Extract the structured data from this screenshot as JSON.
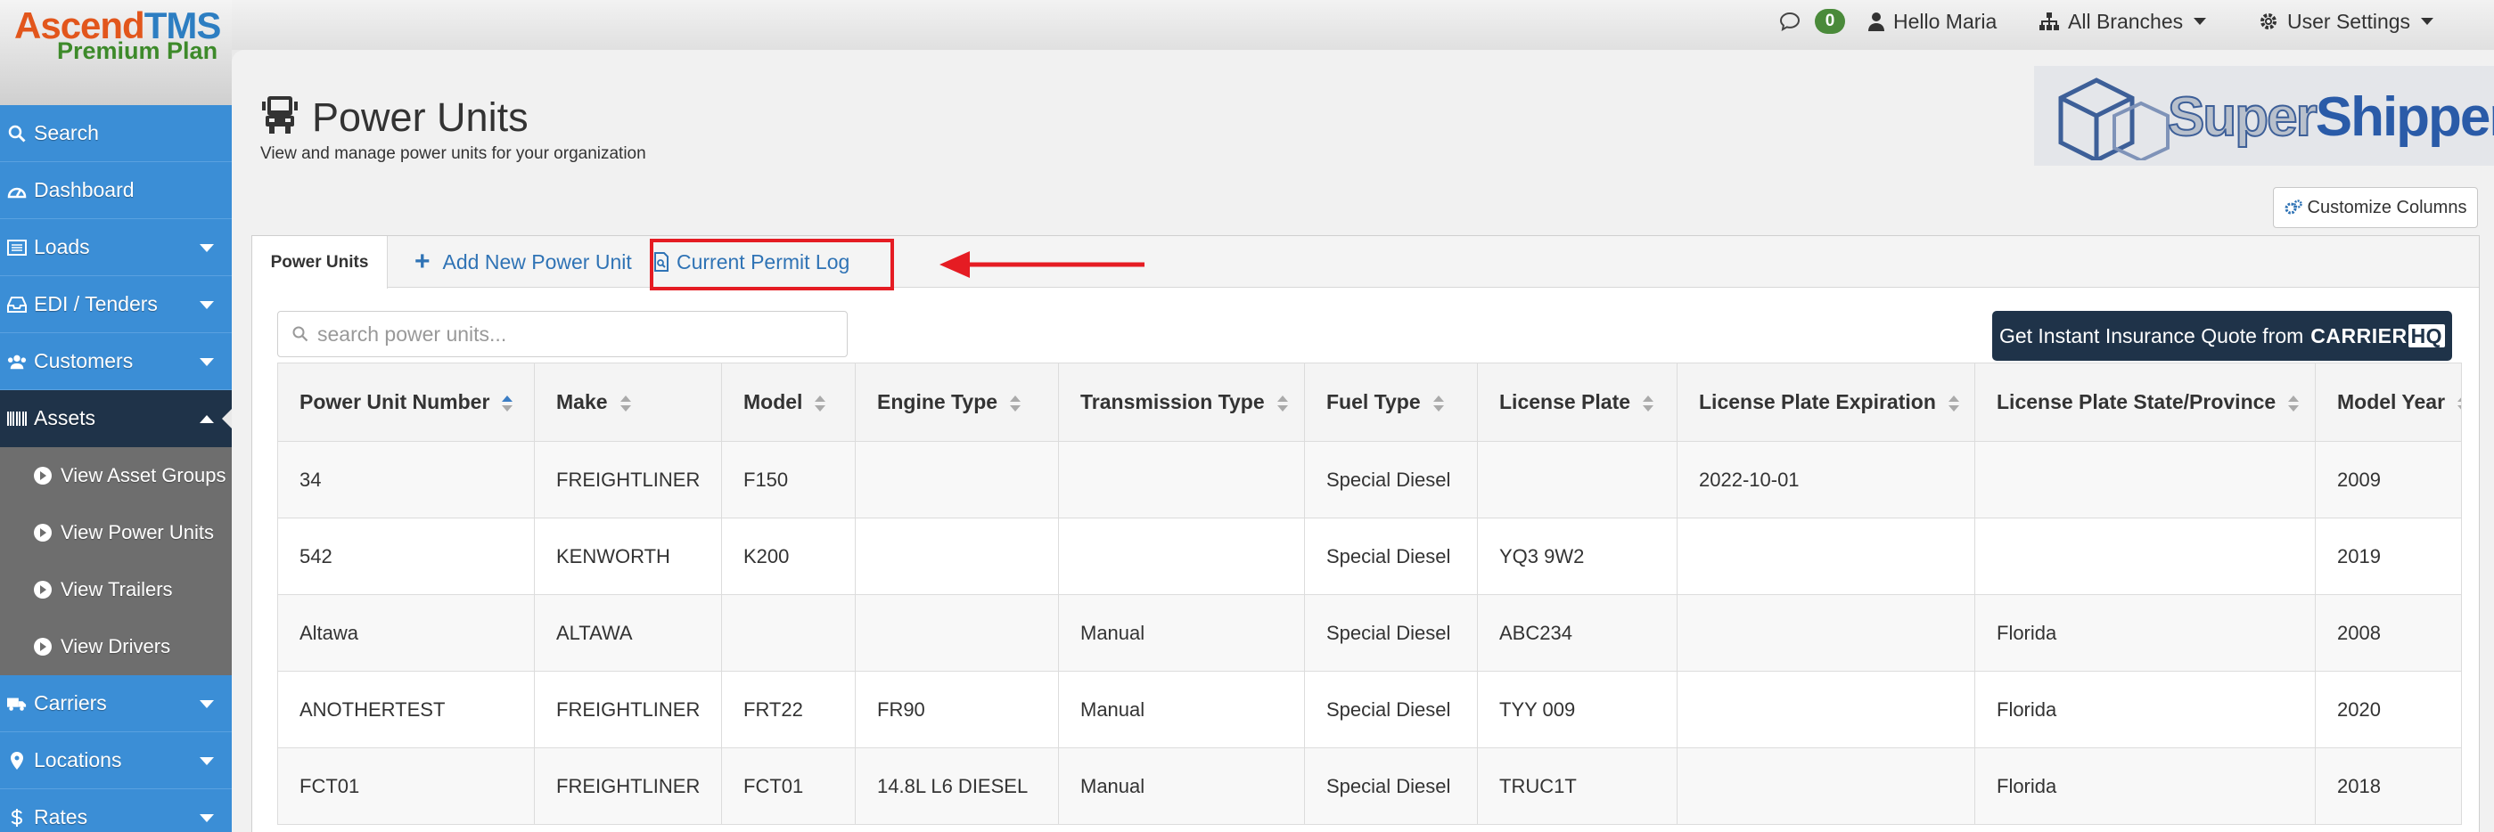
{
  "brand": {
    "name_part1": "Ascend",
    "name_part2": "TMS",
    "plan": "Premium Plan"
  },
  "topbar": {
    "message_count": "0",
    "greeting": "Hello Maria",
    "branches": "All Branches",
    "settings": "User Settings"
  },
  "sidebar": {
    "items": [
      {
        "label": "Search",
        "icon": "search-icon"
      },
      {
        "label": "Dashboard",
        "icon": "dashboard-icon"
      },
      {
        "label": "Loads",
        "icon": "list-icon"
      },
      {
        "label": "EDI / Tenders",
        "icon": "inbox-icon"
      },
      {
        "label": "Customers",
        "icon": "users-icon"
      },
      {
        "label": "Assets",
        "icon": "barcode-icon"
      },
      {
        "label": "Carriers",
        "icon": "truck-icon"
      },
      {
        "label": "Locations",
        "icon": "map-marker-icon"
      },
      {
        "label": "Rates",
        "icon": "dollar-icon"
      }
    ],
    "asset_subitems": [
      "View Asset Groups",
      "View Power Units",
      "View Trailers",
      "View Drivers"
    ]
  },
  "page": {
    "title": "Power Units",
    "subtitle": "View and manage power units for your organization",
    "banner_super": "Super",
    "banner_shippers": "Shippers",
    "customize_columns": "Customize Columns"
  },
  "tabs": {
    "power_units": "Power Units",
    "add_new": "Add New Power Unit",
    "permit_log": "Current Permit Log"
  },
  "search": {
    "placeholder": "search power units..."
  },
  "insurance": {
    "label": "Get Instant Insurance Quote from",
    "brand_a": "CARRIER",
    "brand_b": "HQ"
  },
  "table": {
    "columns": [
      "Power Unit Number",
      "Make",
      "Model",
      "Engine Type",
      "Transmission Type",
      "Fuel Type",
      "License Plate",
      "License Plate Expiration",
      "License Plate State/Province",
      "Model Year"
    ],
    "rows": [
      [
        "34",
        "FREIGHTLINER",
        "F150",
        "",
        "",
        "Special Diesel",
        "",
        "2022-10-01",
        "",
        "2009"
      ],
      [
        "542",
        "KENWORTH",
        "K200",
        "",
        "",
        "Special Diesel",
        "YQ3 9W2",
        "",
        "",
        "2019"
      ],
      [
        "Altawa",
        "ALTAWA",
        "",
        "",
        "Manual",
        "Special Diesel",
        "ABC234",
        "",
        "Florida",
        "2008"
      ],
      [
        "ANOTHERTEST",
        "FREIGHTLINER",
        "FRT22",
        "FR90",
        "Manual",
        "Special Diesel",
        "TYY 009",
        "",
        "Florida",
        "2020"
      ],
      [
        "FCT01",
        "FREIGHTLINER",
        "FCT01",
        "14.8L L6 DIESEL",
        "Manual",
        "Special Diesel",
        "TRUC1T",
        "",
        "Florida",
        "2018"
      ]
    ]
  },
  "colors": {
    "sidebar_blue": "#3b8ed6",
    "sidebar_active": "#1f3349",
    "link_blue": "#2f73b5",
    "highlight_red": "#e51c23",
    "badge_green": "#4a8a3a"
  }
}
